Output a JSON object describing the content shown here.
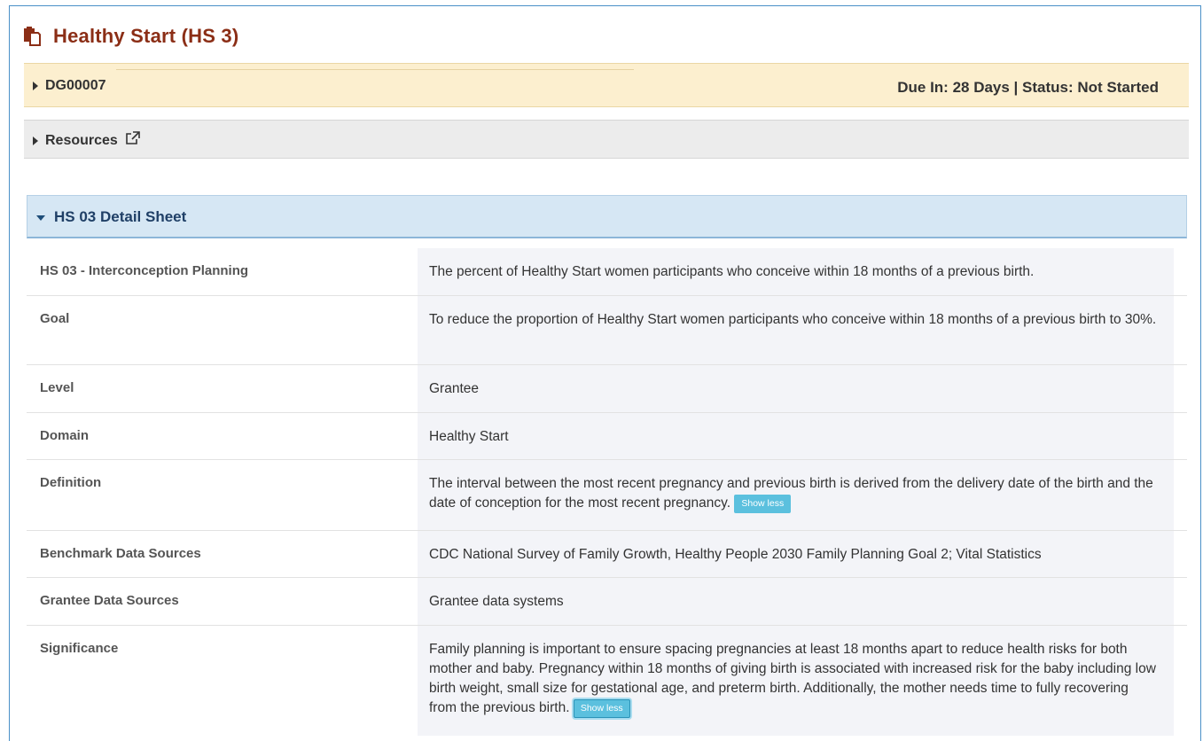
{
  "title": "Healthy Start (HS 3)",
  "icons": {
    "title": "clipboard-icon",
    "external": "external-link-icon"
  },
  "colors": {
    "title": "#8b2e16",
    "dg_panel_bg": "#fcefcf",
    "resources_panel_bg": "#ececec",
    "detail_panel_bg": "#d6e7f4",
    "show_less_button": "#5bc0de"
  },
  "dg_panel": {
    "id": "DG00007",
    "status": "Due In: 28 Days | Status: Not Started"
  },
  "resources_panel": {
    "label": "Resources"
  },
  "detail_panel": {
    "label": "HS 03 Detail Sheet"
  },
  "show_less_label": "Show less",
  "rows": [
    {
      "label": "HS 03 - Interconception Planning",
      "value": "The percent of Healthy Start women participants who conceive within 18 months of a previous birth."
    },
    {
      "label": "Goal",
      "value": "To reduce the proportion of Healthy Start women participants who conceive within 18 months of a previous birth to 30%."
    },
    {
      "label": "Level",
      "value": "Grantee"
    },
    {
      "label": "Domain",
      "value": "Healthy Start"
    },
    {
      "label": "Definition",
      "value": "The interval between the most recent pregnancy and previous birth is derived from the delivery date of the birth and the date of conception for the most recent pregnancy."
    },
    {
      "label": "Benchmark Data Sources",
      "value": "CDC National Survey of Family Growth, Healthy People 2030 Family Planning Goal 2; Vital Statistics"
    },
    {
      "label": "Grantee Data Sources",
      "value": "Grantee data systems"
    },
    {
      "label": "Significance",
      "value": "Family planning is important to ensure spacing pregnancies at least 18 months apart to reduce health risks for both mother and baby. Pregnancy within 18 months of giving birth is associated with increased risk for the baby including low birth weight, small size for gestational age, and preterm birth. Additionally, the mother needs time to fully recovering from the previous birth."
    }
  ]
}
